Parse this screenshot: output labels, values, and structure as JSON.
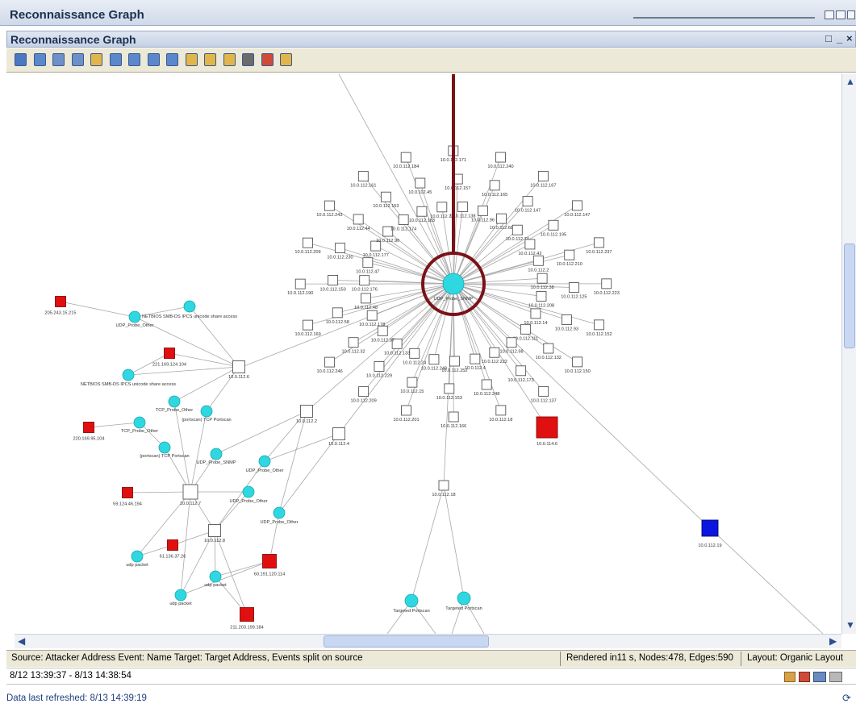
{
  "window": {
    "outer_title": "Reconnaissance Graph",
    "inner_title": "Reconnaissance Graph",
    "inner_controls": [
      "□",
      "_",
      "×"
    ]
  },
  "toolbar": {
    "buttons": [
      {
        "icon": "select-icon",
        "color": "#4a78c2"
      },
      {
        "icon": "pan-icon",
        "color": "#5b88cc"
      },
      {
        "icon": "zoom-in-icon",
        "color": "#6e90c8"
      },
      {
        "icon": "zoom-out-icon",
        "color": "#6e90c8"
      },
      {
        "icon": "fit-to-window-icon",
        "color": "#e0b64a"
      },
      {
        "icon": "hierarchic-layout-icon",
        "color": "#5b88cc"
      },
      {
        "icon": "organic-layout-icon",
        "color": "#5b88cc"
      },
      {
        "icon": "circular-layout-icon",
        "color": "#5b88cc"
      },
      {
        "icon": "grid-layout-icon",
        "color": "#5b88cc"
      },
      {
        "icon": "export-icon",
        "color": "#e0b64a"
      },
      {
        "icon": "image-icon",
        "color": "#e0b64a"
      },
      {
        "icon": "properties-icon",
        "color": "#e0b64a"
      },
      {
        "icon": "print-icon",
        "color": "#6b6b6b"
      },
      {
        "icon": "stop-icon",
        "color": "#d04a3a"
      },
      {
        "icon": "help-icon",
        "color": "#e0b64a"
      }
    ]
  },
  "graph": {
    "hub_label": "UDP_Probe_SNMP",
    "target_nodes": [
      "10.0.112.161",
      "10.0.112.184",
      "10.0.112.171",
      "10.0.112.240",
      "10.0.112.167",
      "10.0.112.147",
      "10.0.112.237",
      "10.0.112.223",
      "10.0.112.152",
      "10.0.112.150",
      "10.0.112.137",
      "10.0.112.18",
      "10.0.112.166",
      "10.0.112.201",
      "10.0.112.209",
      "10.0.112.246",
      "10.0.112.169",
      "10.0.112.190",
      "10.0.112.209",
      "10.0.112.243",
      "10.0.112.45",
      "10.0.112.157",
      "10.0.112.165",
      "10.0.112.147",
      "10.0.112.195",
      "10.0.112.210",
      "10.0.112.125",
      "10.0.112.93",
      "10.0.112.132",
      "10.0.112.173",
      "10.0.112.248",
      "10.0.112.153",
      "10.0.112.15",
      "10.0.112.229",
      "10.0.112.32",
      "10.0.112.58",
      "10.0.112.150",
      "10.0.112.230",
      "10.0.112.44",
      "10.0.112.153",
      "10.0.112.73",
      "10.0.112.138",
      "10.0.112.96",
      "10.0.112.68",
      "10.0.112.74",
      "10.0.112.42",
      "10.0.112.2",
      "10.0.112.38",
      "10.0.112.208",
      "10.0.112.14",
      "10.0.112.111",
      "10.0.112.98",
      "10.0.112.222",
      "10.0.112.4",
      "10.0.112.252",
      "10.0.112.249",
      "10.0.112.24",
      "10.0.112.133",
      "10.0.112.37",
      "10.0.112.178",
      "10.0.112.48",
      "10.0.112.176",
      "10.0.112.47",
      "10.0.112.177",
      "10.0.112.90",
      "10.0.112.174",
      "10.0.112.183"
    ],
    "sub_hubs": [
      "10.0.112.6",
      "10.0.112.2",
      "10.0.112.4",
      "10.0.112.7",
      "10.0.112.8"
    ],
    "attackers": [
      {
        "label": "205.243.15.215",
        "color": "#e01010"
      },
      {
        "label": "221.169.124.104",
        "color": "#e01010"
      },
      {
        "label": "220.169.95.104",
        "color": "#e01010"
      },
      {
        "label": "59.124.46.194",
        "color": "#e01010"
      },
      {
        "label": "61.136.37.26",
        "color": "#e01010"
      },
      {
        "label": "60.191.120.114",
        "color": "#e01010"
      },
      {
        "label": "211.203.199.184",
        "color": "#e01010"
      },
      {
        "label": "10.0.114.6",
        "color": "#e01010"
      }
    ],
    "blue_node": {
      "label": "10.0.112.19",
      "color": "#0a16e0"
    },
    "events": [
      "UDP_Probe_Other",
      "NETBIOS SMB-DS IPCS unicode share access",
      "NETBIOS SMB-DS IPCS unicode share access",
      "TCP_Probe_Other",
      "TCP_Probe_Other",
      "(portscan) TCP Portscan",
      "(portscan) TCP Portscan",
      "UDP_Probe_SNMP",
      "UDP_Probe_Other",
      "UDP_Probe_Other",
      "UDP_Probe_Other",
      "udp packet",
      "udp packet",
      "udp packet",
      "Targeted Portscan",
      "Targeted Portscan"
    ],
    "bottom_hub": "10.0.112.18",
    "colors": {
      "event": "#2fd8e0",
      "attacker": "#e01010",
      "blue": "#0a16e0",
      "highlight": "#7a1218",
      "edge": "#a8a8a8"
    }
  },
  "status": {
    "source": "Source: Attacker Address Event: Name Target: Target Address, Events split on source",
    "render": "Rendered in11 s, Nodes:478, Edges:590",
    "layout": "Layout: Organic Layout",
    "time_range": "8/12 13:39:37 - 8/13 14:38:54",
    "refreshed": "Data last refreshed: 8/13 14:39:19"
  }
}
